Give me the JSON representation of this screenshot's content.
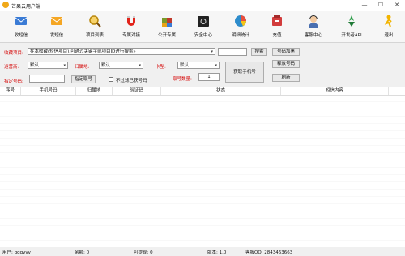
{
  "window": {
    "title": "芒果云用户端",
    "minimize": "—",
    "maximize": "☐",
    "close": "✕"
  },
  "toolbar": [
    {
      "label": "收短信",
      "icon": "receive-sms-icon",
      "color": "#3a7bd5"
    },
    {
      "label": "发短信",
      "icon": "send-sms-icon",
      "color": "#f5a623"
    },
    {
      "label": "项目列表",
      "icon": "search-project-icon",
      "color": "#e8a317"
    },
    {
      "label": "专属对接",
      "icon": "magnet-icon",
      "color": "#e2231a"
    },
    {
      "label": "公开专属",
      "icon": "puzzle-icon",
      "color": "#7a9a2a"
    },
    {
      "label": "安全中心",
      "icon": "safe-icon",
      "color": "#222222"
    },
    {
      "label": "明细统计",
      "icon": "pie-chart-icon",
      "color": "#2d8ccc"
    },
    {
      "label": "充值",
      "icon": "recharge-icon",
      "color": "#d23c3c"
    },
    {
      "label": "客服中心",
      "icon": "customer-service-icon",
      "color": "#4a6fb0"
    },
    {
      "label": "开发者API",
      "icon": "developer-api-icon",
      "color": "#2e9e4a"
    },
    {
      "label": "退出",
      "icon": "exit-icon",
      "color": "#f2b400"
    }
  ],
  "form": {
    "project_label": "收藏项目:",
    "project_value": "在本收藏(短信项目),可通过关键字或项目ID进行搜索»",
    "search_button": "搜索",
    "operator_label": "运营商:",
    "operator_value": "默认",
    "region_label": "归属地:",
    "region_value": "默认",
    "card_label": "卡型:",
    "card_value": "默认",
    "specify_label": "指定号码:",
    "specify_button": "指定取号",
    "exclude_label": "不过滤已获号码",
    "count_label": "取号数量:",
    "count_value": "1",
    "get_button": "获取手机号",
    "release_button": "号码加黑",
    "release2_button": "释放号码",
    "refresh_button": "刷新"
  },
  "table": {
    "columns": [
      "序号",
      "手机号码",
      "归属地",
      "验证码",
      "状态",
      "短信内容"
    ]
  },
  "status": {
    "user": "用户: qqqvvv",
    "balance": "余额: 0",
    "withdraw": "可提现: 0",
    "version": "版本: 1.0",
    "qq": "客服QQ: 2843463663"
  }
}
